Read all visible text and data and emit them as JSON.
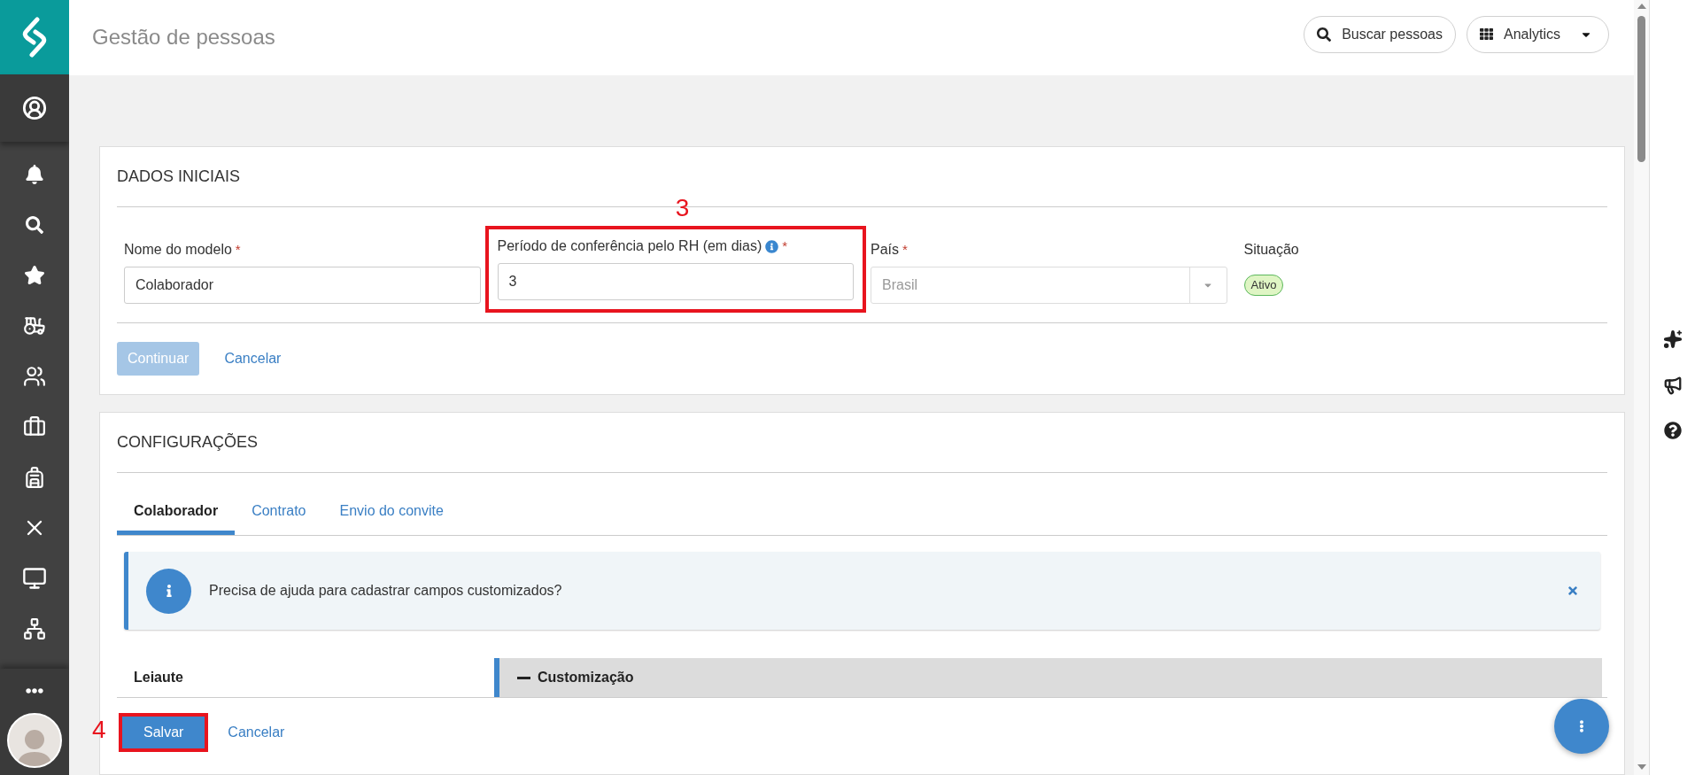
{
  "header": {
    "title": "Gestão de pessoas",
    "search_button": "Buscar pessoas",
    "analytics_button": "Analytics"
  },
  "initial_data": {
    "title": "DADOS INICIAIS",
    "fields": [
      {
        "kind": "text",
        "label": "Nome do modelo",
        "required_mark": "*",
        "info": false,
        "value": "Colaborador",
        "highlighted": false,
        "disabled": false
      },
      {
        "kind": "text",
        "label": "Período de conferência pelo RH (em dias)",
        "required_mark": "*",
        "info": true,
        "value": "3",
        "highlighted": true,
        "annotation": "3",
        "disabled": false
      },
      {
        "kind": "select",
        "label": "País",
        "required_mark": "*",
        "info": false,
        "value": "Brasil",
        "highlighted": false,
        "disabled": true
      },
      {
        "kind": "status",
        "label": "Situação",
        "info": false,
        "value": "Ativo",
        "highlighted": false
      }
    ],
    "continue_button": {
      "label": "Continuar",
      "disabled": true
    },
    "cancel_link": "Cancelar"
  },
  "configurations": {
    "title": "CONFIGURAÇÕES",
    "tabs": [
      {
        "label": "Colaborador",
        "selected": true
      },
      {
        "label": "Contrato",
        "selected": false
      },
      {
        "label": "Envio do convite",
        "selected": false
      }
    ],
    "alert": {
      "text": "Precisa de ajuda para cadastrar campos customizados?"
    },
    "layout_label": "Leiaute",
    "section": {
      "label": "Customização",
      "expanded": true
    }
  },
  "footer": {
    "save_button": {
      "label": "Salvar",
      "highlighted": true,
      "annotation": "4"
    },
    "cancel_link": "Cancelar"
  }
}
